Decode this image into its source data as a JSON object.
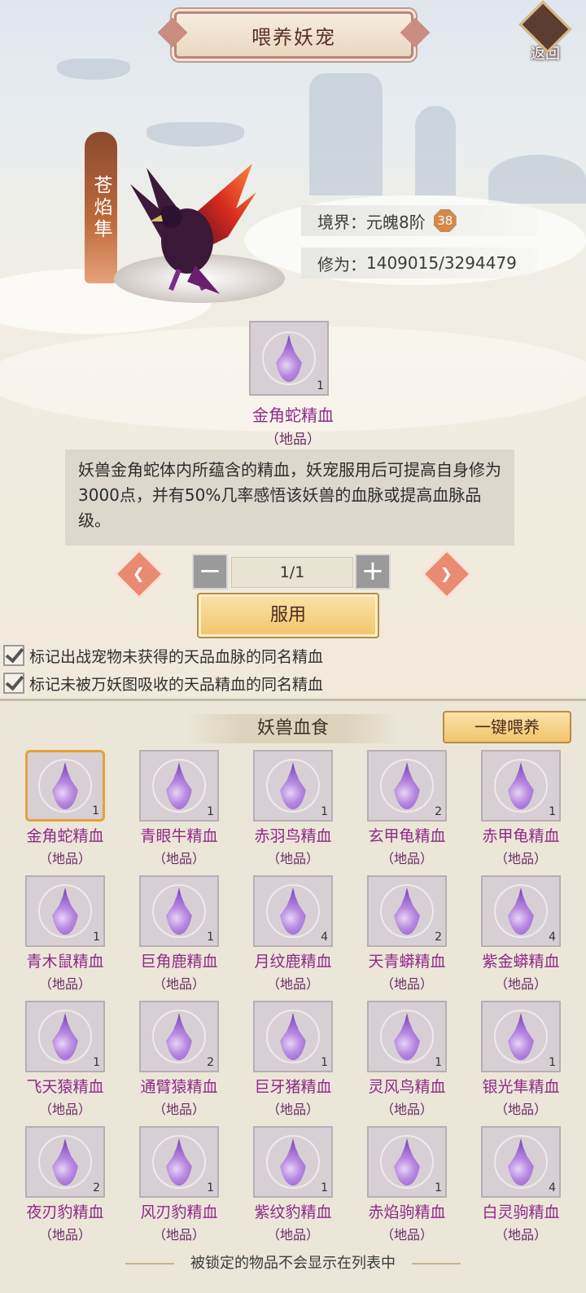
{
  "header": {
    "title": "喂养妖宠",
    "back_label": "返回"
  },
  "pet": {
    "name": "苍焰隼",
    "realm_label": "境界：",
    "realm_value": "元魄8阶",
    "level": "38",
    "cultivation_label": "修为：",
    "cultivation_value": "1409015/3294479"
  },
  "selected_item": {
    "name": "金角蛇精血",
    "grade": "（地品）",
    "count": "1",
    "description": "妖兽金角蛇体内所蕴含的精血，妖宠服用后可提高自身修为3000点，并有50%几率感悟该妖兽的血脉或提高血脉品级。"
  },
  "quantity": {
    "value": "1/1",
    "minus": "−",
    "plus": "+",
    "prev": "❮",
    "next": "❯"
  },
  "use_button": "服用",
  "checkboxes": [
    {
      "label": "标记出战宠物未获得的天品血脉的同名精血",
      "checked": true
    },
    {
      "label": "标记未被万妖图吸收的天品精血的同名精血",
      "checked": true
    }
  ],
  "panel": {
    "title": "妖兽血食",
    "feed_all": "一键喂养",
    "footer": "被锁定的物品不会显示在列表中",
    "items": [
      {
        "name": "金角蛇精血",
        "grade": "（地品）",
        "count": "1"
      },
      {
        "name": "青眼牛精血",
        "grade": "（地品）",
        "count": "1"
      },
      {
        "name": "赤羽鸟精血",
        "grade": "（地品）",
        "count": "1"
      },
      {
        "name": "玄甲龟精血",
        "grade": "（地品）",
        "count": "2"
      },
      {
        "name": "赤甲龟精血",
        "grade": "（地品）",
        "count": "1"
      },
      {
        "name": "青木鼠精血",
        "grade": "（地品）",
        "count": "1"
      },
      {
        "name": "巨角鹿精血",
        "grade": "（地品）",
        "count": "1"
      },
      {
        "name": "月纹鹿精血",
        "grade": "（地品）",
        "count": "4"
      },
      {
        "name": "天青蟒精血",
        "grade": "（地品）",
        "count": "2"
      },
      {
        "name": "紫金蟒精血",
        "grade": "（地品）",
        "count": "4"
      },
      {
        "name": "飞天猿精血",
        "grade": "（地品）",
        "count": "1"
      },
      {
        "name": "通臂猿精血",
        "grade": "（地品）",
        "count": "2"
      },
      {
        "name": "巨牙猪精血",
        "grade": "（地品）",
        "count": "1"
      },
      {
        "name": "灵风鸟精血",
        "grade": "（地品）",
        "count": "1"
      },
      {
        "name": "银光隼精血",
        "grade": "（地品）",
        "count": "1"
      },
      {
        "name": "夜刃豹精血",
        "grade": "（地品）",
        "count": "2"
      },
      {
        "name": "风刃豹精血",
        "grade": "（地品）",
        "count": "1"
      },
      {
        "name": "紫纹豹精血",
        "grade": "（地品）",
        "count": "1"
      },
      {
        "name": "赤焰驹精血",
        "grade": "（地品）",
        "count": "1"
      },
      {
        "name": "白灵驹精血",
        "grade": "（地品）",
        "count": "4"
      }
    ]
  }
}
